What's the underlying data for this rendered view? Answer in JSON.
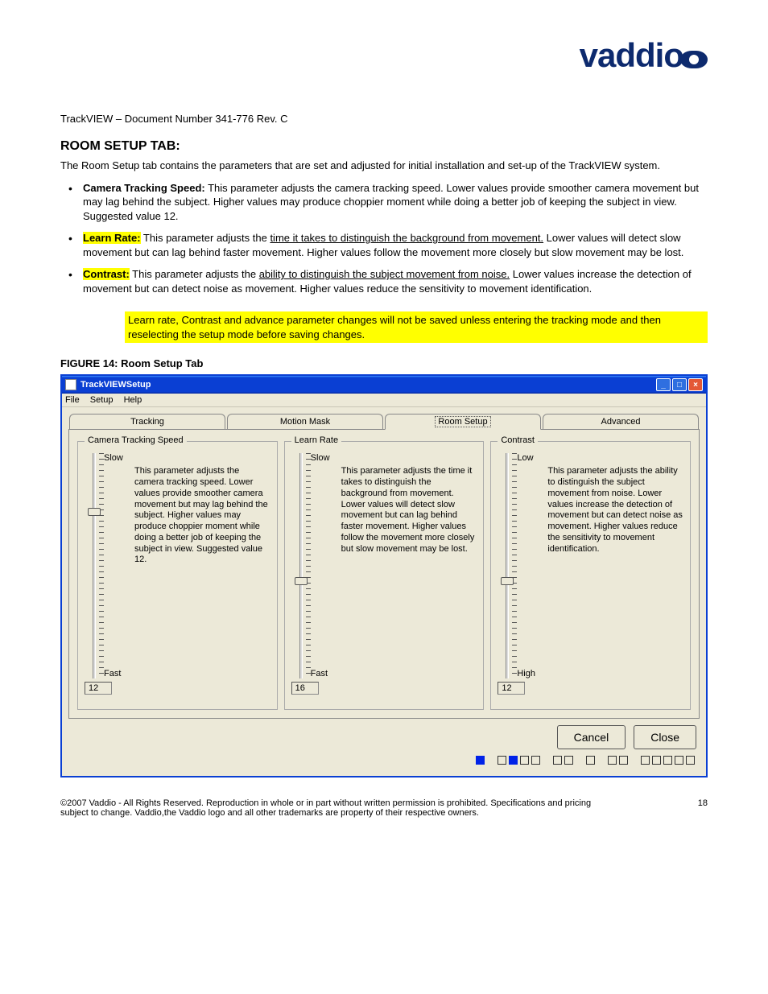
{
  "brand": "vaddio",
  "doc_header": "TrackVIEW – Document Number 341-776 Rev. C",
  "section_title": "ROOM SETUP TAB:",
  "intro": "The Room Setup tab contains the parameters that are set and adjusted for initial installation and set-up of the TrackVIEW system.",
  "bullets": {
    "b0": {
      "label": "Camera Tracking Speed:",
      "text": "  This parameter adjusts the camera tracking speed.  Lower values provide smoother camera movement but may lag behind the subject.  Higher values may produce choppier moment while doing a better job of keeping the subject in view.  Suggested value 12."
    },
    "b1": {
      "label": "Learn Rate:",
      "text_a": "  This parameter adjusts the ",
      "text_b": "time it takes to distinguish the background from movement.",
      "text_c": "  Lower values will detect slow movement but can lag behind faster movement. Higher values follow the movement more closely but slow movement may be lost."
    },
    "b2": {
      "label": "Contrast:",
      "text_a": "  This parameter adjusts the ",
      "text_b": "ability to distinguish the subject movement from noise.",
      "text_c": "  Lower values increase the detection of movement but can detect noise as movement. Higher values reduce the sensitivity to movement identification."
    }
  },
  "highlight_block": "Learn rate, Contrast and advance parameter changes will not be saved unless entering the tracking mode and then reselecting the setup mode before saving changes.",
  "figure_label": "FIGURE 14:  Room Setup Tab",
  "window": {
    "title": "TrackVIEWSetup",
    "menus": [
      "File",
      "Setup",
      "Help"
    ],
    "tabs": [
      "Tracking",
      "Motion Mask",
      "Room Setup",
      "Advanced"
    ],
    "selected_tab": "Room Setup",
    "groups": {
      "g0": {
        "title": "Camera Tracking Speed",
        "top_label": "Slow",
        "bottom_label": "Fast",
        "value": "12",
        "thumb_pct": 24,
        "desc": "This parameter adjusts the camera tracking speed.  Lower values provide smoother camera movement but may lag behind the subject.  Higher values may produce choppier moment while doing a better job of keeping the subject in view.  Suggested value 12."
      },
      "g1": {
        "title": "Learn Rate",
        "top_label": "Slow",
        "bottom_label": "Fast",
        "value": "16",
        "thumb_pct": 55,
        "desc": "This parameter adjusts the time it takes to distinguish the background from movement.  Lower values will detect slow movement but can lag behind faster movement. Higher values follow the movement more closely but slow movement may be lost."
      },
      "g2": {
        "title": "Contrast",
        "top_label": "Low",
        "bottom_label": "High",
        "value": "12",
        "thumb_pct": 55,
        "desc": "This parameter adjusts the ability to distinguish the subject movement from noise. Lower values increase the detection of movement but can detect noise as movement. Higher values reduce the sensitivity to movement identification."
      }
    },
    "buttons": {
      "cancel": "Cancel",
      "close": "Close"
    },
    "leds": [
      true,
      false,
      true,
      false,
      false,
      false,
      false,
      false,
      false,
      false,
      false,
      false,
      false,
      false,
      false
    ]
  },
  "footer_left": "©2007 Vaddio - All Rights Reserved. Reproduction in whole or in part without written permission is prohibited. Specifications and pricing subject to change. Vaddio,the Vaddio logo and all other trademarks are property of their respective owners.",
  "footer_right": "18"
}
